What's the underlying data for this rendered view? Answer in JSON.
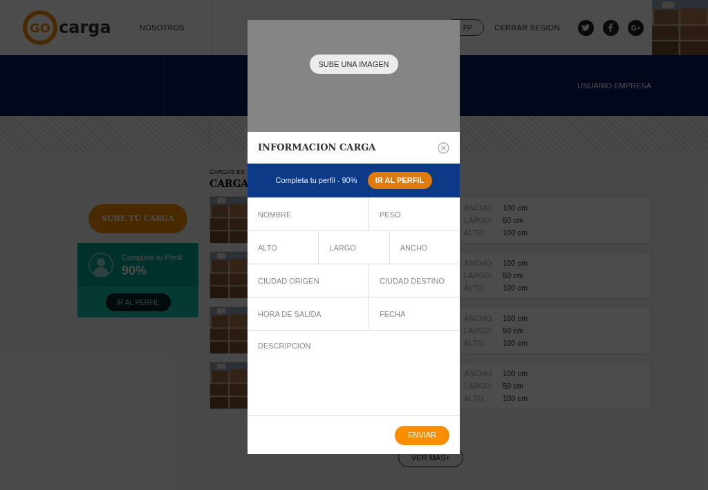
{
  "header": {
    "logo": {
      "mark": "GO",
      "word": "carga"
    },
    "nav": [
      "NOSOTROS"
    ],
    "app_button": "PP",
    "logout": "CERRAR SESION"
  },
  "banner": {
    "user_label": "USUARIO EMPRESA"
  },
  "sidebar": {
    "upload_button": "SUBE TU CARGA",
    "profile_card": {
      "label": "Completa tu Perfil",
      "percent": "90%",
      "button": "IR AL PERFIL"
    }
  },
  "content": {
    "subtitle": "CARGAS ES",
    "title": "CARGA",
    "cargo_list": [
      {
        "specs": [
          {
            "label": "ANCHO:",
            "value": "100 cm"
          },
          {
            "label": "LARGO:",
            "value": "50 cm"
          },
          {
            "label": "ALTO:",
            "value": "100 cm"
          }
        ]
      },
      {
        "specs": [
          {
            "label": "ANCHO:",
            "value": "100 cm"
          },
          {
            "label": "LARGO:",
            "value": "50 cm"
          },
          {
            "label": "ALTO:",
            "value": "100 cm"
          }
        ]
      },
      {
        "specs": [
          {
            "label": "ANCHO:",
            "value": "100 cm"
          },
          {
            "label": "LARGO:",
            "value": "50 cm"
          },
          {
            "label": "ALTO:",
            "value": "100 cm"
          }
        ]
      },
      {
        "specs": [
          {
            "label": "ANCHO:",
            "value": "100 cm"
          },
          {
            "label": "LARGO:",
            "value": "50 cm"
          },
          {
            "label": "ALTO:",
            "value": "100 cm"
          }
        ]
      }
    ],
    "more_button": "VER MAS+"
  },
  "modal": {
    "upload_image_button": "SUBE UNA IMAGEN",
    "title": "INFORMACION CARGA",
    "profile_banner": {
      "text": "Completa tu perfil - 90%",
      "button": "IR AL PERFIL"
    },
    "field_rows": [
      [
        {
          "placeholder": "NOMBRE"
        },
        {
          "placeholder": "PESO"
        }
      ],
      [
        {
          "placeholder": "ALTO"
        },
        {
          "placeholder": "LARGO"
        },
        {
          "placeholder": "ANCHO"
        }
      ],
      [
        {
          "placeholder": "CIUDAD ORIGEN"
        },
        {
          "placeholder": "CIUDAD DESTINO"
        }
      ],
      [
        {
          "placeholder": "HORA DE SALIDA"
        },
        {
          "placeholder": "FECHA"
        }
      ]
    ],
    "description": {
      "placeholder": "DESCRIPCION"
    },
    "submit_button": "ENVIAR"
  }
}
